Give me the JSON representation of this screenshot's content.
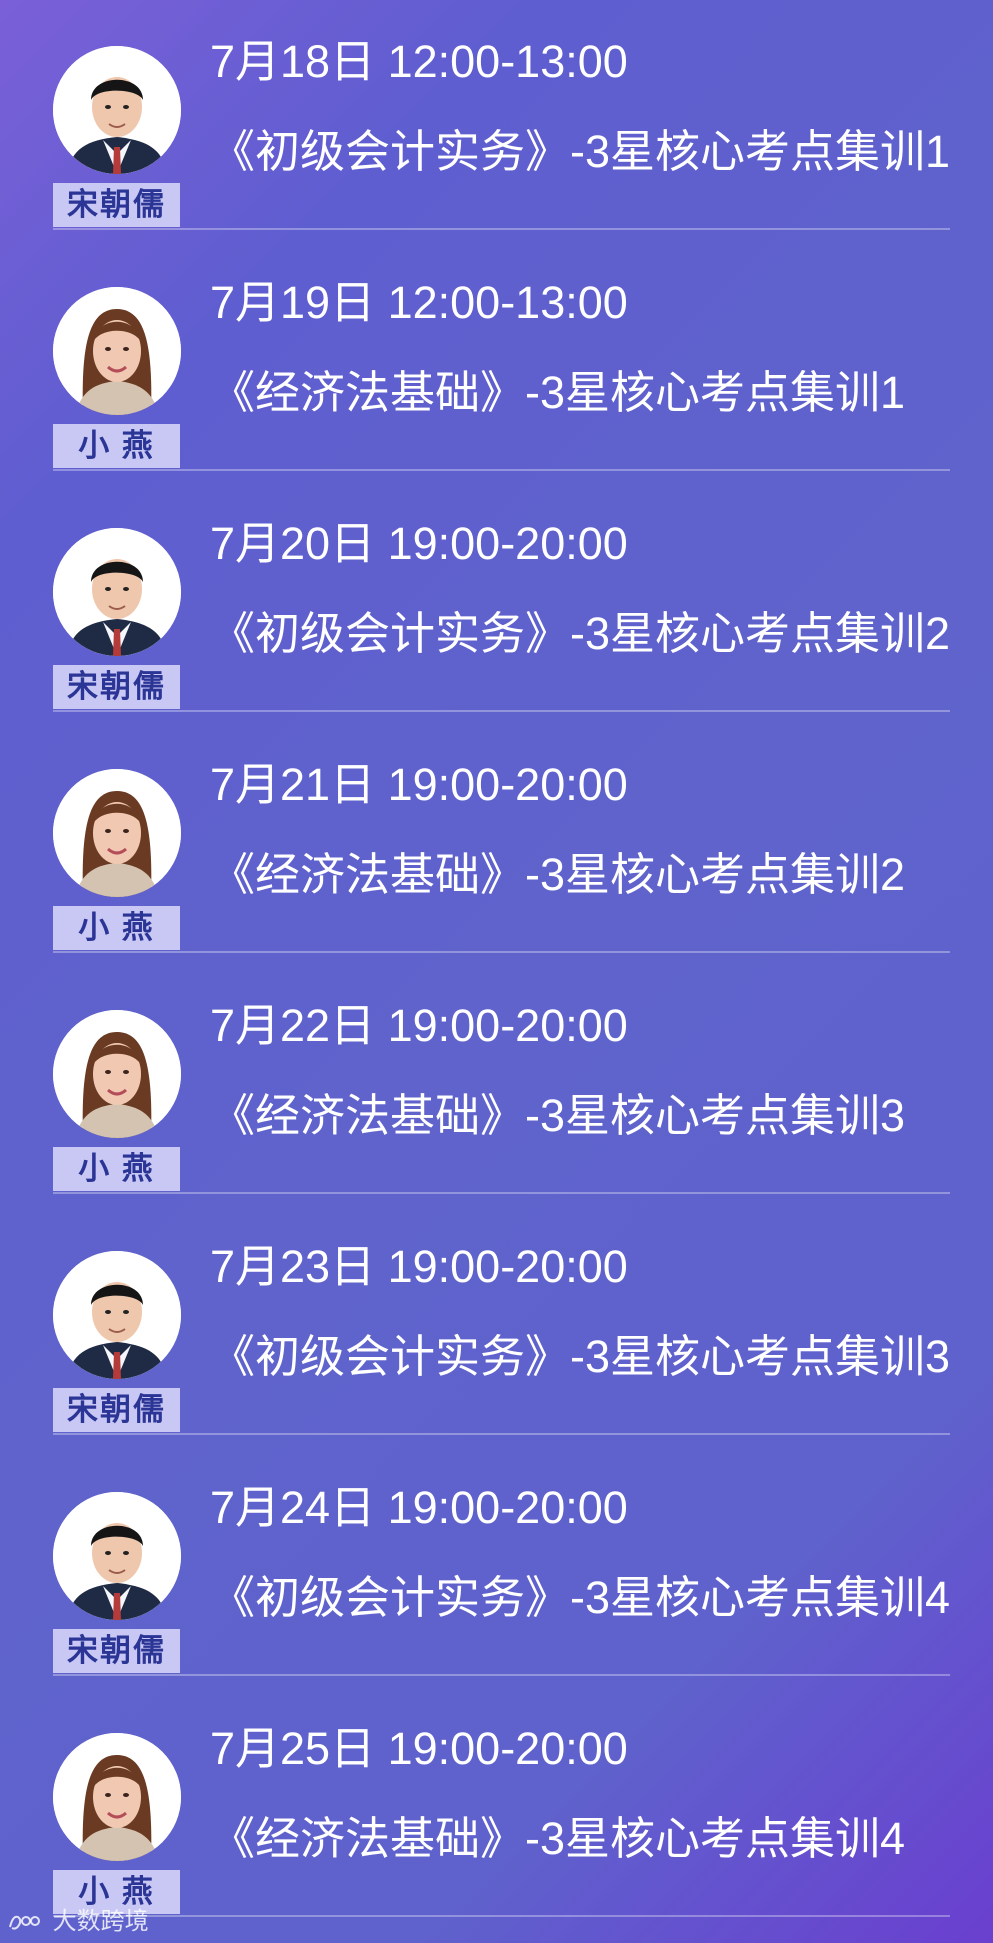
{
  "sessions": [
    {
      "date_time": "7月18日  12:00-13:00",
      "course": "《初级会计实务》-3星核心考点集训1",
      "instructor": "宋朝儒",
      "avatar_icon": "male-instructor-avatar"
    },
    {
      "date_time": "7月19日  12:00-13:00",
      "course": "《经济法基础》-3星核心考点集训1",
      "instructor": "小 燕",
      "avatar_icon": "female-instructor-avatar"
    },
    {
      "date_time": "7月20日  19:00-20:00",
      "course": "《初级会计实务》-3星核心考点集训2",
      "instructor": "宋朝儒",
      "avatar_icon": "male-instructor-avatar"
    },
    {
      "date_time": "7月21日  19:00-20:00",
      "course": "《经济法基础》-3星核心考点集训2",
      "instructor": "小 燕",
      "avatar_icon": "female-instructor-avatar"
    },
    {
      "date_time": "7月22日  19:00-20:00",
      "course": "《经济法基础》-3星核心考点集训3",
      "instructor": "小 燕",
      "avatar_icon": "female-instructor-avatar"
    },
    {
      "date_time": "7月23日  19:00-20:00",
      "course": "《初级会计实务》-3星核心考点集训3",
      "instructor": "宋朝儒",
      "avatar_icon": "male-instructor-avatar"
    },
    {
      "date_time": "7月24日  19:00-20:00",
      "course": "《初级会计实务》-3星核心考点集训4",
      "instructor": "宋朝儒",
      "avatar_icon": "male-instructor-avatar"
    },
    {
      "date_time": "7月25日  19:00-20:00",
      "course": "《经济法基础》-3星核心考点集训4",
      "instructor": "小 燕",
      "avatar_icon": "female-instructor-avatar"
    }
  ],
  "watermark": {
    "text": "大数跨境"
  },
  "colors": {
    "background": "#5f63cb",
    "text": "#ffffff",
    "name_tag_background": "#c9c8f5",
    "name_tag_text": "#2b3596"
  }
}
